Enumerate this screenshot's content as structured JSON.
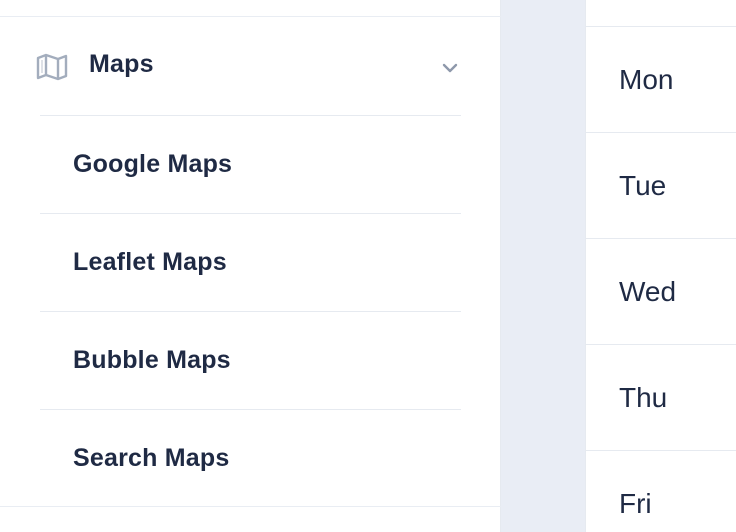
{
  "sidebar": {
    "maps_section": {
      "label": "Maps",
      "icon": "map-icon",
      "expanded": true,
      "items": [
        {
          "label": "Google Maps"
        },
        {
          "label": "Leaflet Maps"
        },
        {
          "label": "Bubble Maps"
        },
        {
          "label": "Search Maps"
        }
      ]
    }
  },
  "calendar": {
    "days": [
      "Mon",
      "Tue",
      "Wed",
      "Thu",
      "Fri"
    ]
  },
  "colors": {
    "text": "#1f2a44",
    "icon": "#a3adbd",
    "divider": "#e6eaf0",
    "background": "#e9edf5",
    "panel": "#ffffff"
  }
}
